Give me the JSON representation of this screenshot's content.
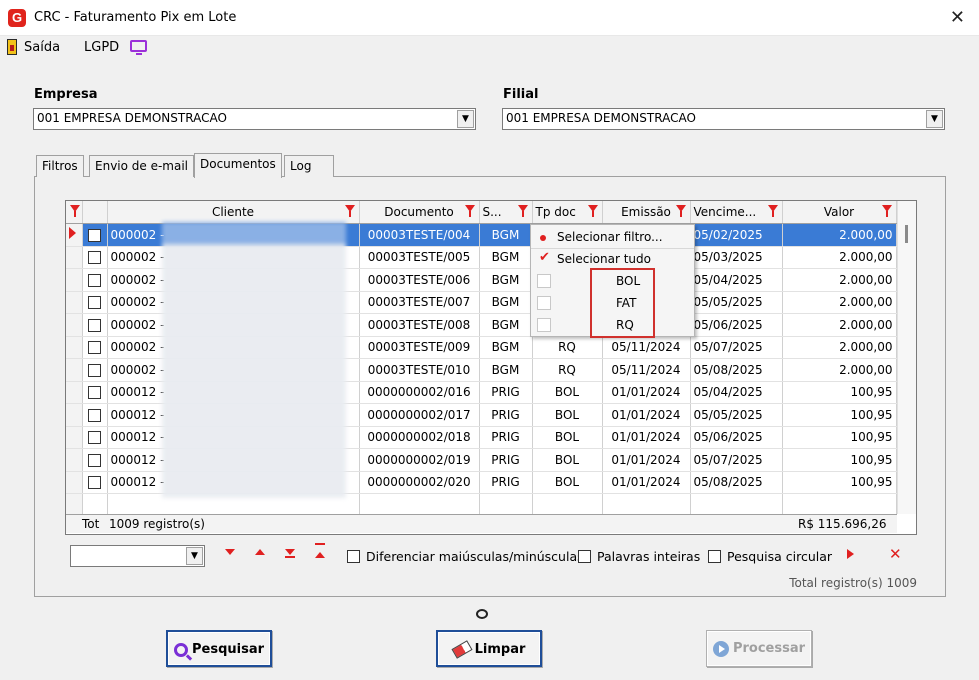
{
  "window": {
    "title": "CRC - Faturamento Pix em Lote",
    "app_icon_letter": "G"
  },
  "menubar": {
    "exit_label": "Saída",
    "lgpd_label": "LGPD"
  },
  "empresa": {
    "label": "Empresa",
    "value": "001 EMPRESA DEMONSTRACAO"
  },
  "filial": {
    "label": "Filial",
    "value": "001 EMPRESA DEMONSTRACAO"
  },
  "tabs": [
    {
      "label": "Filtros"
    },
    {
      "label": "Envio de e-mail"
    },
    {
      "label": "Documentos"
    },
    {
      "label": "Log"
    }
  ],
  "grid": {
    "headers": {
      "cliente": "Cliente",
      "documento": "Documento",
      "situacao": "S...",
      "tpdoc": "Tp doc",
      "emissao": "Emissão",
      "vencimento": "Vencime...",
      "valor": "Valor"
    },
    "rows": [
      {
        "cliente": "000002 -",
        "documento": "00003TESTE/004",
        "s": "BGM",
        "tp": "",
        "emissao": "",
        "venc": "05/02/2025",
        "valor": "2.000,00",
        "selected": true
      },
      {
        "cliente": "000002 -",
        "documento": "00003TESTE/005",
        "s": "BGM",
        "tp": "",
        "emissao": "",
        "venc": "05/03/2025",
        "valor": "2.000,00",
        "selected": false
      },
      {
        "cliente": "000002 -",
        "documento": "00003TESTE/006",
        "s": "BGM",
        "tp": "",
        "emissao": "",
        "venc": "05/04/2025",
        "valor": "2.000,00",
        "selected": false
      },
      {
        "cliente": "000002 -",
        "documento": "00003TESTE/007",
        "s": "BGM",
        "tp": "",
        "emissao": "",
        "venc": "05/05/2025",
        "valor": "2.000,00",
        "selected": false
      },
      {
        "cliente": "000002 -",
        "documento": "00003TESTE/008",
        "s": "BGM",
        "tp": "",
        "emissao": "",
        "venc": "05/06/2025",
        "valor": "2.000,00",
        "selected": false
      },
      {
        "cliente": "000002 -",
        "documento": "00003TESTE/009",
        "s": "BGM",
        "tp": "RQ",
        "emissao": "05/11/2024",
        "venc": "05/07/2025",
        "valor": "2.000,00",
        "selected": false
      },
      {
        "cliente": "000002 -",
        "documento": "00003TESTE/010",
        "s": "BGM",
        "tp": "RQ",
        "emissao": "05/11/2024",
        "venc": "05/08/2025",
        "valor": "2.000,00",
        "selected": false
      },
      {
        "cliente": "000012 -",
        "documento": "0000000002/016",
        "s": "PRIG",
        "tp": "BOL",
        "emissao": "01/01/2024",
        "venc": "05/04/2025",
        "valor": "100,95",
        "selected": false
      },
      {
        "cliente": "000012 -",
        "documento": "0000000002/017",
        "s": "PRIG",
        "tp": "BOL",
        "emissao": "01/01/2024",
        "venc": "05/05/2025",
        "valor": "100,95",
        "selected": false
      },
      {
        "cliente": "000012 -",
        "documento": "0000000002/018",
        "s": "PRIG",
        "tp": "BOL",
        "emissao": "01/01/2024",
        "venc": "05/06/2025",
        "valor": "100,95",
        "selected": false
      },
      {
        "cliente": "000012 -",
        "documento": "0000000002/019",
        "s": "PRIG",
        "tp": "BOL",
        "emissao": "01/01/2024",
        "venc": "05/07/2025",
        "valor": "100,95",
        "selected": false
      },
      {
        "cliente": "000012 -",
        "documento": "0000000002/020",
        "s": "PRIG",
        "tp": "BOL",
        "emissao": "01/01/2024",
        "venc": "05/08/2025",
        "valor": "100,95",
        "selected": false
      }
    ],
    "totals": {
      "tot_label": "Tot",
      "records": "1009 registro(s)",
      "valor_total": "R$ 115.696,26"
    }
  },
  "filter_popup": {
    "select_filter": "Selecionar filtro...",
    "select_all": "Selecionar tudo",
    "options": [
      "BOL",
      "FAT",
      "RQ"
    ]
  },
  "search": {
    "case_sensitive": "Diferenciar maiúsculas/minúsculas",
    "whole_words": "Palavras inteiras",
    "circular": "Pesquisa circular",
    "total_records": "Total registro(s) 1009"
  },
  "buttons": {
    "pesquisar": "Pesquisar",
    "limpar": "Limpar",
    "processar": "Processar"
  },
  "colors": {
    "accent": "#e02020",
    "selection": "#3a7bd5",
    "highlight_box": "#d0312d"
  }
}
